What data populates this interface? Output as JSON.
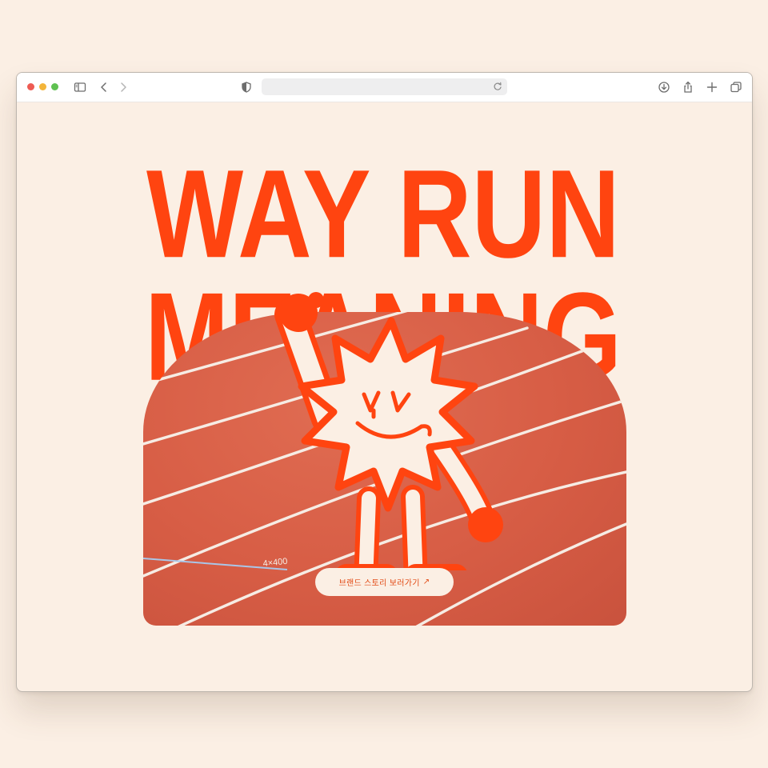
{
  "browser": {
    "address_text": "",
    "icons": [
      "sidebar-icon",
      "back-icon",
      "forward-icon",
      "privacy-shield-icon",
      "reload-icon",
      "download-icon",
      "share-icon",
      "new-tab-icon",
      "tab-overview-icon"
    ]
  },
  "hero": {
    "line1": "WAY RUN",
    "line2": "MEANING",
    "cta_label": "브랜드 스토리 보러가기",
    "cta_arrow": "↗",
    "track_marking": "4×400",
    "accent_color": "#ff4410",
    "background_color": "#fbefe4",
    "track_color": "#d75d45"
  }
}
